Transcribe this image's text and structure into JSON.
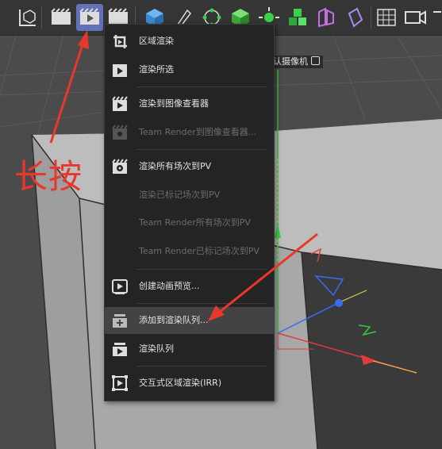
{
  "viewport": {
    "camera_label": "认摄像机 ",
    "camera_icon": "camera-link-icon"
  },
  "toolbar": {
    "icons": [
      "coordinate-axis-icon",
      "render-view-icon",
      "render-active-view-icon",
      "render-menu-icon",
      "cube-icon",
      "pen-icon",
      "subdivision-icon",
      "generator-icon",
      "cloner-icon",
      "mograph-icon",
      "deformer-icon",
      "field-icon",
      "grid-icon",
      "camera-icon"
    ],
    "active": "render-active-view-icon"
  },
  "menu": {
    "items": [
      {
        "label": "区域渲染",
        "icon": "region-render-icon",
        "disabled": false
      },
      {
        "label": "渲染所选",
        "icon": "render-selected-icon",
        "disabled": false
      },
      {
        "label": "渲染到图像查看器",
        "icon": "render-to-picture-viewer-icon",
        "disabled": false
      },
      {
        "label": "Team Render到图像查看器...",
        "icon": "team-render-icon",
        "disabled": true
      },
      {
        "label": "渲染所有场次到PV",
        "icon": "render-all-takes-icon",
        "disabled": false
      },
      {
        "label": "渲染已标记场次到PV",
        "icon": "",
        "disabled": true
      },
      {
        "label": "Team Render所有场次到PV",
        "icon": "",
        "disabled": true
      },
      {
        "label": "Team Render已标记场次到PV",
        "icon": "",
        "disabled": true
      },
      {
        "label": "创建动画预览...",
        "icon": "make-preview-icon",
        "disabled": false
      },
      {
        "label": "添加到渲染队列...",
        "icon": "add-to-render-queue-icon",
        "disabled": false,
        "highlighted": true
      },
      {
        "label": "渲染队列",
        "icon": "render-queue-icon",
        "disabled": false
      },
      {
        "label": "交互式区域渲染(IRR)",
        "icon": "interactive-region-render-icon",
        "disabled": false
      }
    ]
  },
  "annotation": {
    "text": "长按",
    "color": "#e8382c"
  },
  "colors": {
    "accent_active": "#6272b8",
    "menu_bg": "#242424",
    "menu_highlight": "#434343",
    "annotation_red": "#e8382c"
  }
}
